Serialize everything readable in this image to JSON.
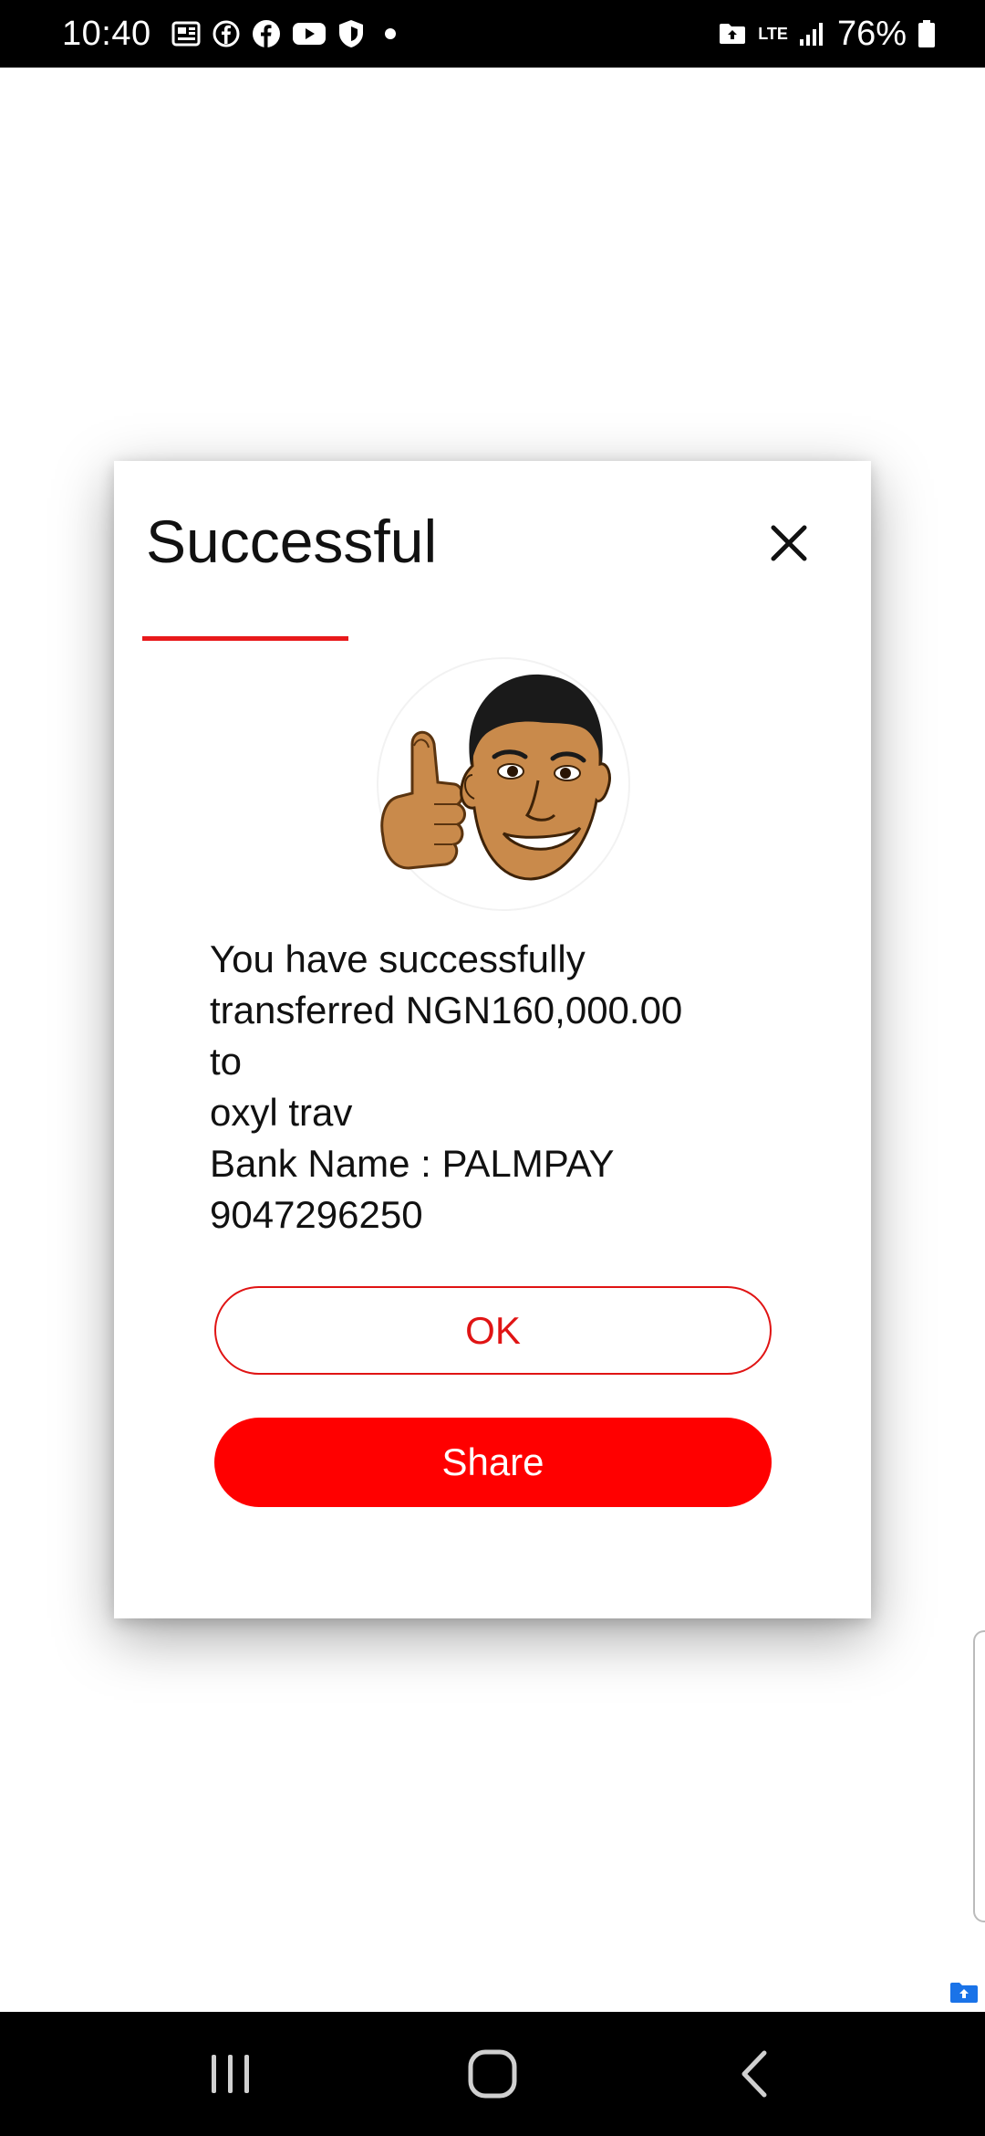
{
  "status_bar": {
    "time": "10:40",
    "battery": "76%",
    "network": "LTE",
    "left_icons": [
      "news-icon",
      "facebook-outline-icon",
      "facebook-icon",
      "youtube-icon",
      "shield-icon"
    ],
    "right_icons": [
      "upload-folder-icon",
      "lte-icon",
      "signal-icon",
      "battery-icon"
    ]
  },
  "dialog": {
    "title": "Successful",
    "accent_color": "#e8191b",
    "message": {
      "line1": "You have successfully",
      "line2": "transferred NGN160,000.00",
      "line3": "to",
      "line4": "oxyl trav",
      "line5": "Bank Name : PALMPAY",
      "line6": "9047296250"
    },
    "ok_label": "OK",
    "share_label": "Share"
  },
  "nav_bar": {
    "icons": [
      "recents-icon",
      "home-icon",
      "back-icon"
    ]
  }
}
